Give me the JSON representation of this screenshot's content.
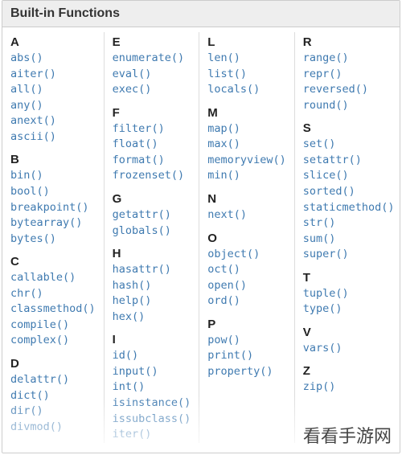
{
  "title": "Built-in Functions",
  "watermark": "看看手游网",
  "columns": [
    {
      "groups": [
        {
          "letter": "A",
          "fns": [
            "abs()",
            "aiter()",
            "all()",
            "any()",
            "anext()",
            "ascii()"
          ]
        },
        {
          "letter": "B",
          "fns": [
            "bin()",
            "bool()",
            "breakpoint()",
            "bytearray()",
            "bytes()"
          ]
        },
        {
          "letter": "C",
          "fns": [
            "callable()",
            "chr()",
            "classmethod()",
            "compile()",
            "complex()"
          ]
        },
        {
          "letter": "D",
          "fns": [
            "delattr()",
            "dict()",
            "dir()",
            "divmod()"
          ]
        }
      ]
    },
    {
      "groups": [
        {
          "letter": "E",
          "fns": [
            "enumerate()",
            "eval()",
            "exec()"
          ]
        },
        {
          "letter": "F",
          "fns": [
            "filter()",
            "float()",
            "format()",
            "frozenset()"
          ]
        },
        {
          "letter": "G",
          "fns": [
            "getattr()",
            "globals()"
          ]
        },
        {
          "letter": "H",
          "fns": [
            "hasattr()",
            "hash()",
            "help()",
            "hex()"
          ]
        },
        {
          "letter": "I",
          "fns": [
            "id()",
            "input()",
            "int()",
            "isinstance()",
            "issubclass()",
            "iter()"
          ]
        }
      ]
    },
    {
      "groups": [
        {
          "letter": "L",
          "fns": [
            "len()",
            "list()",
            "locals()"
          ]
        },
        {
          "letter": "M",
          "fns": [
            "map()",
            "max()",
            "memoryview()",
            "min()"
          ]
        },
        {
          "letter": "N",
          "fns": [
            "next()"
          ]
        },
        {
          "letter": "O",
          "fns": [
            "object()",
            "oct()",
            "open()",
            "ord()"
          ]
        },
        {
          "letter": "P",
          "fns": [
            "pow()",
            "print()",
            "property()"
          ]
        }
      ]
    },
    {
      "groups": [
        {
          "letter": "R",
          "fns": [
            "range()",
            "repr()",
            "reversed()",
            "round()"
          ]
        },
        {
          "letter": "S",
          "fns": [
            "set()",
            "setattr()",
            "slice()",
            "sorted()",
            "staticmethod()",
            "str()",
            "sum()",
            "super()"
          ]
        },
        {
          "letter": "T",
          "fns": [
            "tuple()",
            "type()"
          ]
        },
        {
          "letter": "V",
          "fns": [
            "vars()"
          ]
        },
        {
          "letter": "Z",
          "fns": [
            "zip()"
          ]
        }
      ]
    }
  ]
}
